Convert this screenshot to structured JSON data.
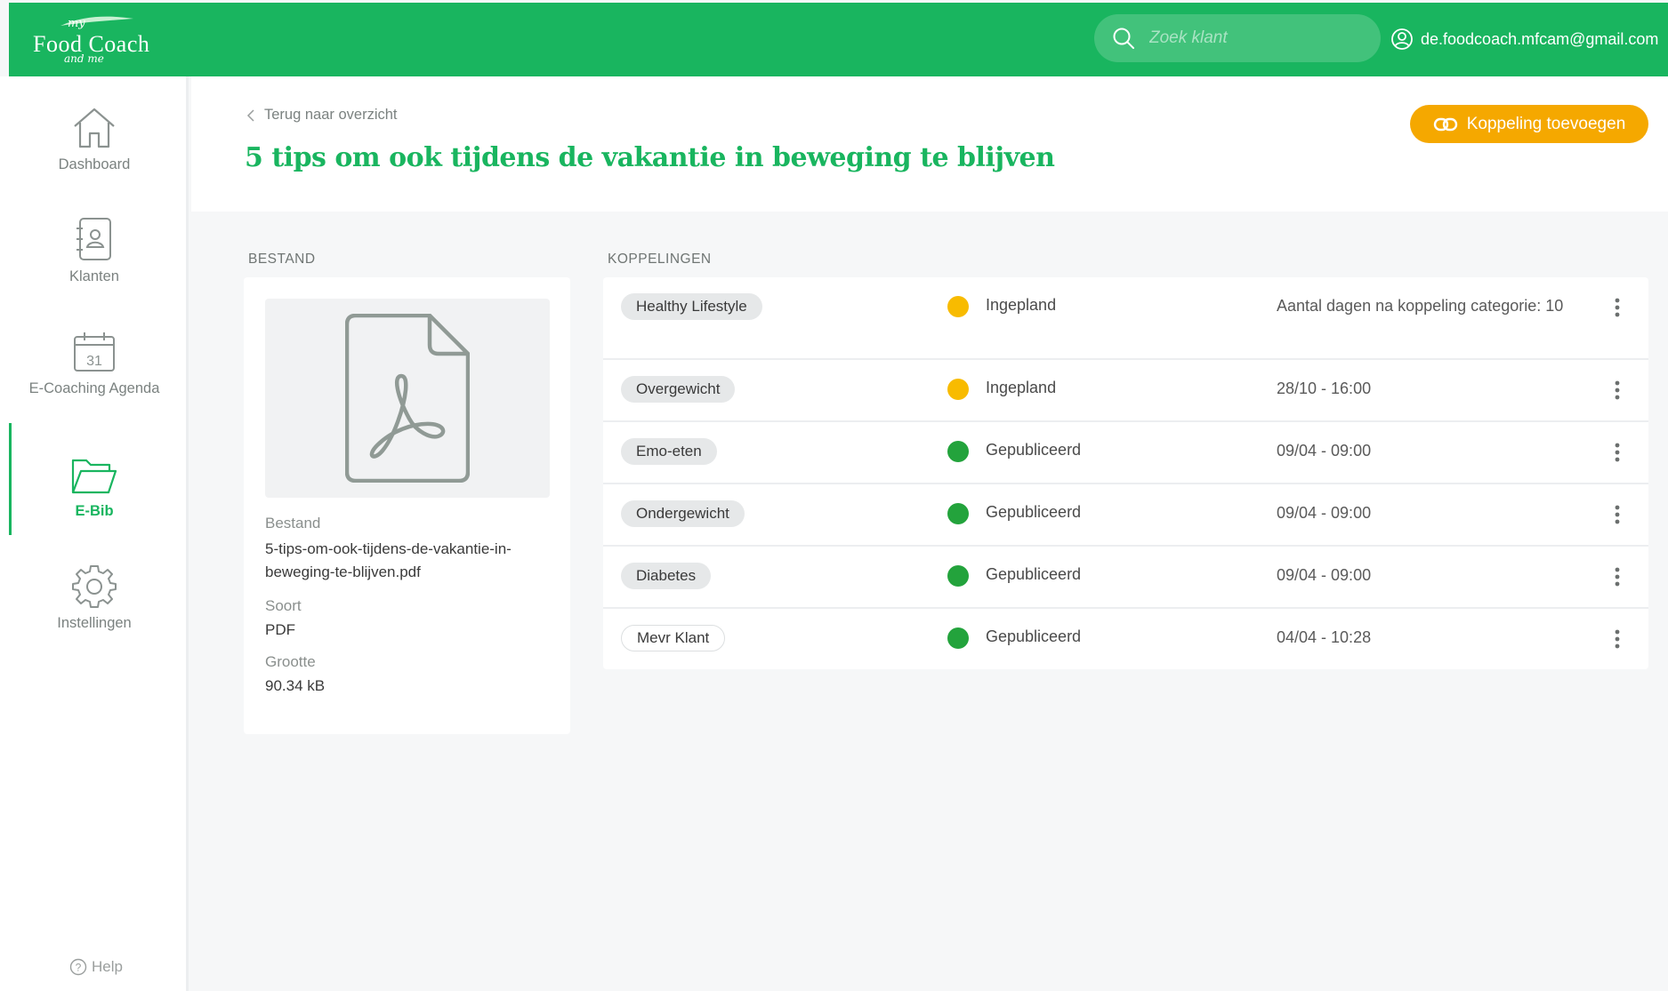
{
  "app": {
    "logo": {
      "my": "my",
      "brand": "Food Coach",
      "andme": "and me"
    },
    "search": {
      "placeholder": "Zoek klant",
      "value": ""
    },
    "user_email": "de.foodcoach.mfcam@gmail.com"
  },
  "sidebar": {
    "items": [
      {
        "label": "Dashboard",
        "icon": "home-icon",
        "active": false
      },
      {
        "label": "Klanten",
        "icon": "contacts-icon",
        "active": false
      },
      {
        "label": "E-Coaching Agenda",
        "icon": "calendar-icon",
        "calendar_day": "31",
        "active": false
      },
      {
        "label": "E-Bib",
        "icon": "folder-icon",
        "active": true
      },
      {
        "label": "Instellingen",
        "icon": "gear-icon",
        "active": false
      }
    ],
    "help": "Help"
  },
  "header": {
    "back_label": "Terug naar overzicht",
    "title": "5 tips om ook tijdens de vakantie in beweging te blijven",
    "add_button": "Koppeling toevoegen"
  },
  "file": {
    "section_label": "BESTAND",
    "preview_icon": "pdf-file-icon",
    "fields": [
      {
        "label": "Bestand",
        "value": "5-tips-om-ook-tijdens-de-vakantie-in-beweging-te-blijven.pdf"
      },
      {
        "label": "Soort",
        "value": "PDF"
      },
      {
        "label": "Grootte",
        "value": "90.34 kB"
      }
    ]
  },
  "links": {
    "section_label": "KOPPELINGEN",
    "rows": [
      {
        "tag": "Healthy Lifestyle",
        "status": "Ingepland",
        "status_color": "#f8bb00",
        "when": "Aantal dagen na koppeling categorie: 10"
      },
      {
        "tag": "Overgewicht",
        "status": "Ingepland",
        "status_color": "#f8bb00",
        "when": "28/10 - 16:00"
      },
      {
        "tag": "Emo-eten",
        "status": "Gepubliceerd",
        "status_color": "#23a33c",
        "when": "09/04 - 09:00"
      },
      {
        "tag": "Ondergewicht",
        "status": "Gepubliceerd",
        "status_color": "#23a33c",
        "when": "09/04 - 09:00"
      },
      {
        "tag": "Diabetes",
        "status": "Gepubliceerd",
        "status_color": "#23a33c",
        "when": "09/04 - 09:00"
      },
      {
        "tag": "Mevr Klant",
        "status": "Gepubliceerd",
        "status_color": "#23a33c",
        "when": "04/04 - 10:28"
      }
    ]
  },
  "colors": {
    "brand": "#19b55f",
    "accent": "#f5a800",
    "scheduled": "#f8bb00",
    "published": "#23a33c"
  }
}
